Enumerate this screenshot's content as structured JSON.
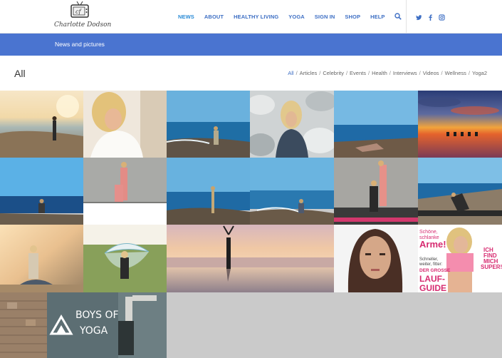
{
  "header": {
    "logo_text": "Charlotte Dodson",
    "nav": [
      {
        "label": "NEWS",
        "active": true
      },
      {
        "label": "ABOUT"
      },
      {
        "label": "HEALTHY LIVING"
      },
      {
        "label": "YOGA"
      },
      {
        "label": "SIGN IN"
      },
      {
        "label": "SHOP"
      },
      {
        "label": "HELP"
      }
    ],
    "search_icon": "search-icon",
    "social_icons": [
      "twitter-icon",
      "facebook-icon",
      "instagram-icon"
    ]
  },
  "banner": {
    "title": "News and pictures"
  },
  "filter_bar": {
    "heading": "All",
    "filters": [
      "All",
      "Articles",
      "Celebrity",
      "Events",
      "Health",
      "Interviews",
      "Videos",
      "Wellness",
      "Yoga2"
    ],
    "active": "All"
  },
  "gallery": {
    "tile_count": 19,
    "boys_of_yoga": {
      "line1": "BOYS OF",
      "line2": "YOGA"
    },
    "magazine": {
      "headline1": "Schöne,",
      "headline2": "schlanke",
      "headline3": "Arme!",
      "side1": "ICH",
      "side2": "FIND",
      "side3": "MICH",
      "side4": "SUPER!",
      "sub1": "Schneller,",
      "sub2": "weiter, fitter:",
      "sub3": "DER GROSSE",
      "sub4": "LAUF-",
      "sub5": "GUIDE"
    }
  },
  "colors": {
    "accent_blue": "#4a74d0",
    "nav_blue": "#3e6fc4",
    "grid_background": "#cacaca"
  }
}
